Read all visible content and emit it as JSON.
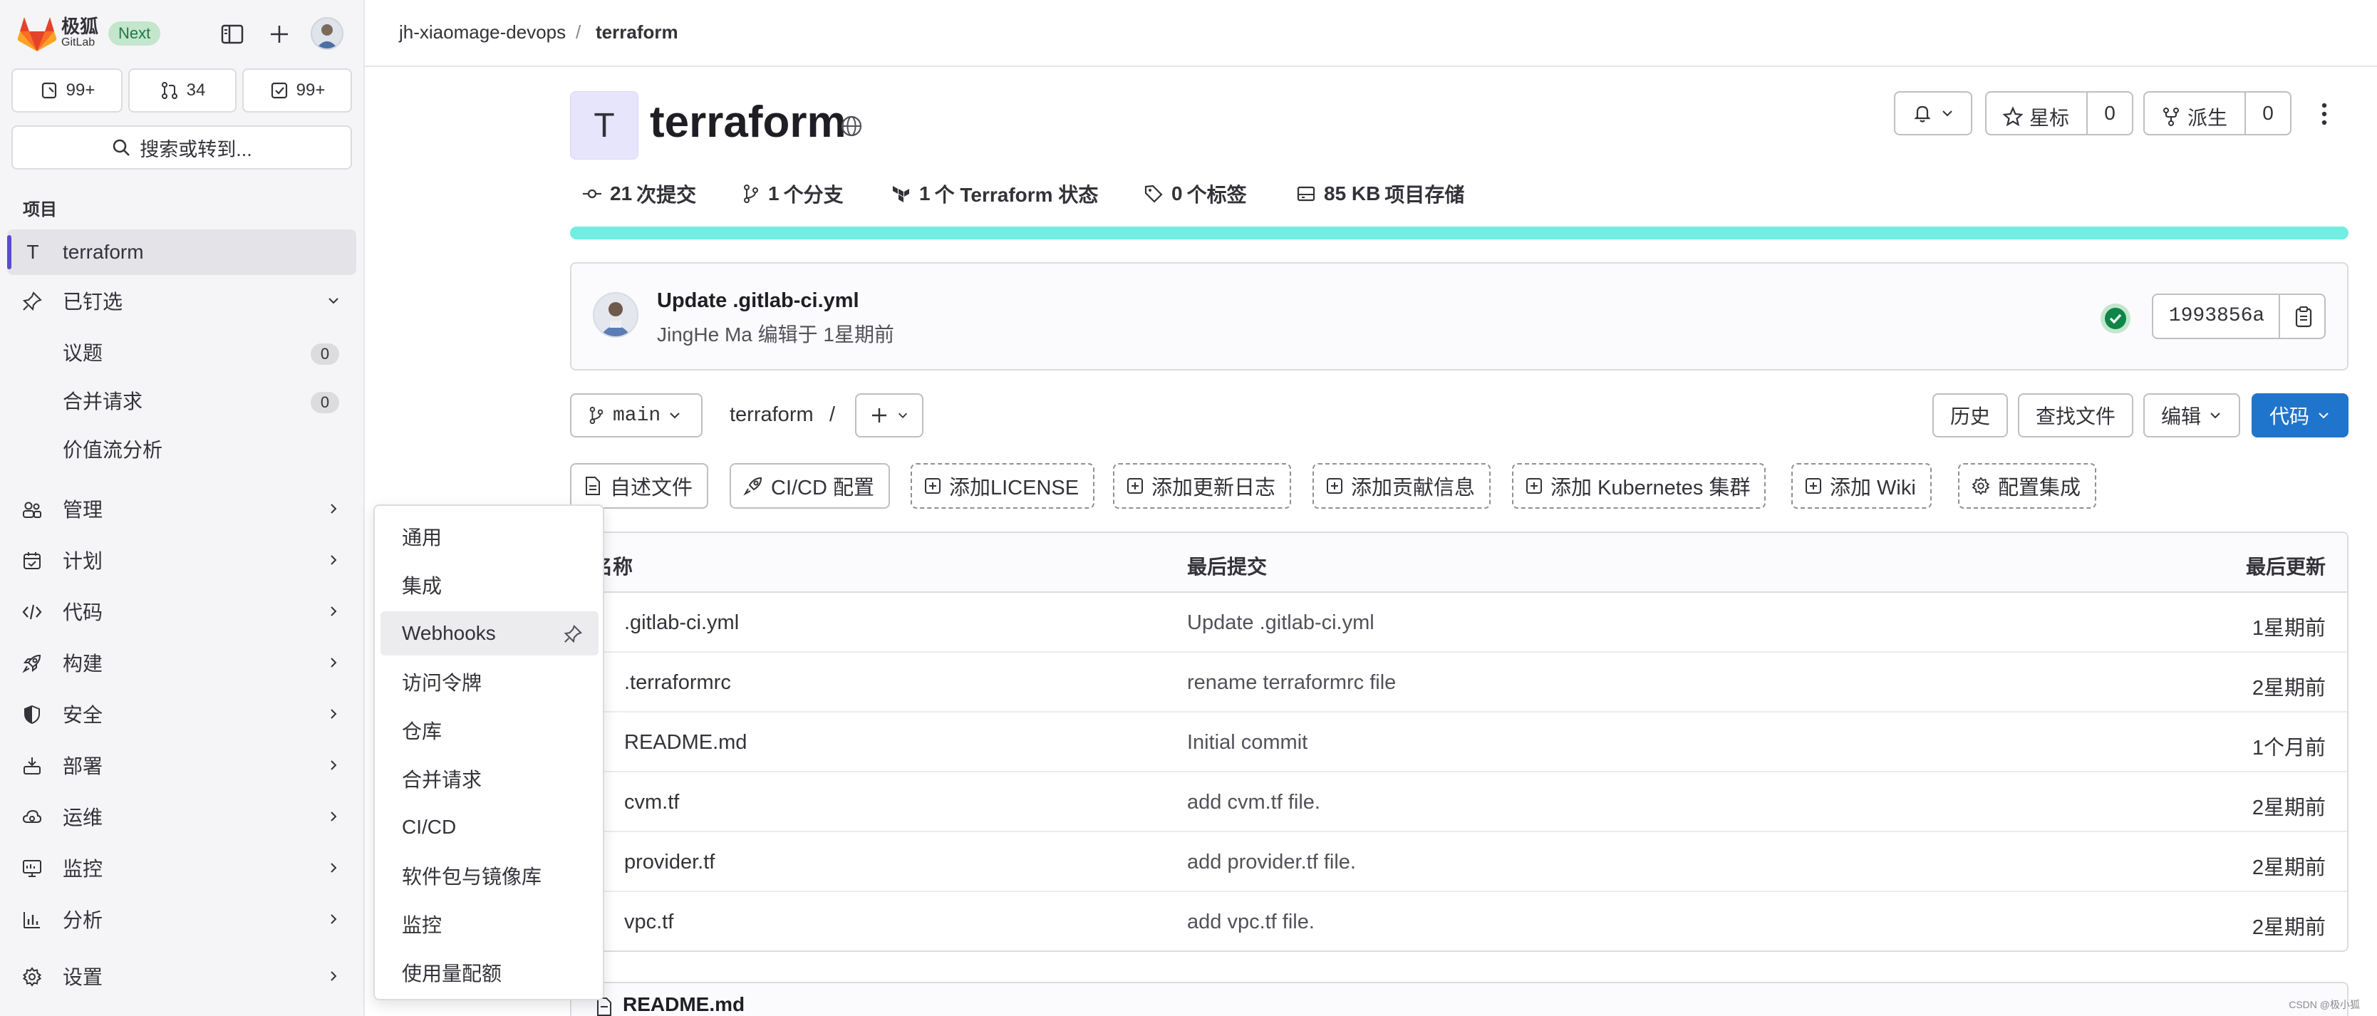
{
  "brand": {
    "name": "极狐",
    "sub": "GitLab",
    "badge": "Next"
  },
  "counters": {
    "issues": "99+",
    "merge_requests": "34",
    "todos": "99+"
  },
  "search": {
    "label": "搜索或转到..."
  },
  "sidebar": {
    "section_label": "项目",
    "project": {
      "initial": "T",
      "name": "terraform"
    },
    "pinned": {
      "label": "已钉选",
      "items": [
        {
          "label": "议题",
          "count": "0"
        },
        {
          "label": "合并请求",
          "count": "0"
        },
        {
          "label": "价值流分析"
        }
      ]
    },
    "items": [
      {
        "label": "管理",
        "icon": "users-icon"
      },
      {
        "label": "计划",
        "icon": "calendar-icon"
      },
      {
        "label": "代码",
        "icon": "code-icon"
      },
      {
        "label": "构建",
        "icon": "rocket-icon"
      },
      {
        "label": "安全",
        "icon": "shield-icon"
      },
      {
        "label": "部署",
        "icon": "deploy-icon"
      },
      {
        "label": "运维",
        "icon": "cloud-icon"
      },
      {
        "label": "监控",
        "icon": "monitor-icon"
      },
      {
        "label": "分析",
        "icon": "chart-icon"
      },
      {
        "label": "设置",
        "icon": "gear-icon"
      }
    ]
  },
  "flyout": {
    "items": [
      "通用",
      "集成",
      "Webhooks",
      "访问令牌",
      "仓库",
      "合并请求",
      "CI/CD",
      "软件包与镜像库",
      "监控",
      "使用量配额"
    ],
    "hovered": "Webhooks"
  },
  "breadcrumb": {
    "group": "jh-xiaomage-devops",
    "separator": "/",
    "project": "terraform"
  },
  "project": {
    "initial": "T",
    "title": "terraform",
    "star_label": "星标",
    "star_count": "0",
    "fork_label": "派生",
    "fork_count": "0"
  },
  "stats": {
    "commits": {
      "value": "21",
      "label": "次提交"
    },
    "branches": {
      "value": "1",
      "label": "个分支"
    },
    "terraform": {
      "value": "1",
      "label": "个 Terraform 状态"
    },
    "tags": {
      "value": "0",
      "label": "个标签"
    },
    "storage": {
      "value": "85 KB",
      "label": "项目存储"
    }
  },
  "storage_bar": {
    "fill_percent": 100,
    "color": "#72ede2"
  },
  "last_commit": {
    "title": "Update .gitlab-ci.yml",
    "author": "JingHe Ma",
    "action": "编辑于 1星期前",
    "sha": "1993856a",
    "status_color": "#108548"
  },
  "toolbar": {
    "branch": "main",
    "path": "terraform",
    "path_sep": "/",
    "history": "历史",
    "find_file": "查找文件",
    "edit": "编辑",
    "code": "代码"
  },
  "quick_actions": {
    "readme": "自述文件",
    "cicd": "CI/CD 配置",
    "license": "添加LICENSE",
    "changelog": "添加更新日志",
    "contributing": "添加贡献信息",
    "k8s": "添加 Kubernetes 集群",
    "wiki": "添加 Wiki",
    "integrations": "配置集成"
  },
  "files": {
    "headers": {
      "name": "名称",
      "last_commit": "最后提交",
      "last_update": "最后更新"
    },
    "rows": [
      {
        "name": ".gitlab-ci.yml",
        "commit": "Update .gitlab-ci.yml",
        "updated": "1星期前"
      },
      {
        "name": ".terraformrc",
        "commit": "rename terraformrc file",
        "updated": "2星期前"
      },
      {
        "name": "README.md",
        "commit": "Initial commit",
        "updated": "1个月前"
      },
      {
        "name": "cvm.tf",
        "commit": "add cvm.tf file.",
        "updated": "2星期前"
      },
      {
        "name": "provider.tf",
        "commit": "add provider.tf file.",
        "updated": "2星期前"
      },
      {
        "name": "vpc.tf",
        "commit": "add vpc.tf file.",
        "updated": "2星期前"
      }
    ]
  },
  "readme": {
    "title": "README.md"
  },
  "watermark": "CSDN @极小狐"
}
